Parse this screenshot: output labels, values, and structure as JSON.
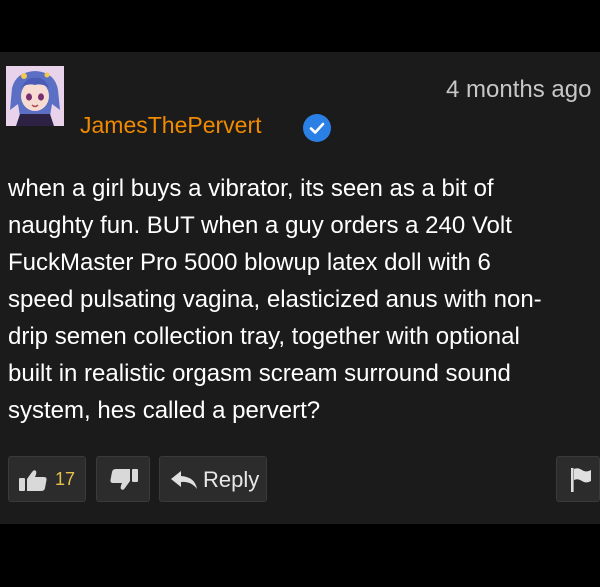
{
  "comment": {
    "timestamp": "4 months ago",
    "username": "JamesThePervert",
    "verified": true,
    "text_lines": [
      "when a girl buys a vibrator, its seen as a bit of",
      "naughty fun. BUT when a guy orders a 240 Volt",
      "FuckMaster Pro 5000 blowup latex doll with 6",
      "speed pulsating vagina, elasticized anus with non-",
      "drip semen collection tray, together with optional",
      "built in realistic orgasm scream surround sound",
      "system, hes called a pervert?"
    ]
  },
  "actions": {
    "like_count": "17",
    "reply_label": "Reply"
  },
  "icons": {
    "like": "thumbs-up-icon",
    "dislike": "thumbs-down-icon",
    "reply": "reply-arrow-icon",
    "flag": "flag-icon",
    "verified": "verified-check-icon"
  },
  "colors": {
    "background": "#000000",
    "card": "#1b1b1b",
    "username": "#f08a00",
    "verified_badge": "#2b80e6",
    "like_count": "#e8c14a",
    "text": "#ffffff",
    "timestamp": "#c7c7c7"
  }
}
